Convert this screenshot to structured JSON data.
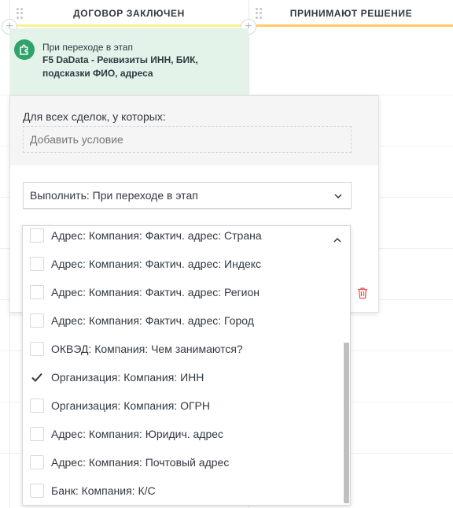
{
  "stages": [
    {
      "name": "ДОГОВОР ЗАКЛЮЧЕН",
      "color": "#f7f48a"
    },
    {
      "name": "ПРИНИМАЮТ РЕШЕНИЕ",
      "color": "#ffcc66"
    }
  ],
  "trigger": {
    "caption": "При переходе в этап",
    "title": "F5 DaData - Реквизиты ИНН, БИК, подсказки ФИО, адреса",
    "icon": "puzzle-icon"
  },
  "popup": {
    "condition_label": "Для всех сделок, у которых:",
    "condition_placeholder": "Добавить условие",
    "execute_value": "Выполнить: При переходе в этап"
  },
  "fields": [
    {
      "label": "Адрес: Компания: Фактич. адрес: Страна",
      "checked": false
    },
    {
      "label": "Адрес: Компания: Фактич. адрес: Индекс",
      "checked": false
    },
    {
      "label": "Адрес: Компания: Фактич. адрес: Регион",
      "checked": false
    },
    {
      "label": "Адрес: Компания: Фактич. адрес: Город",
      "checked": false
    },
    {
      "label": "ОКВЭД: Компания: Чем занимаются?",
      "checked": false
    },
    {
      "label": "Организация: Компания: ИНН",
      "checked": true
    },
    {
      "label": "Организация: Компания: ОГРН",
      "checked": false
    },
    {
      "label": "Адрес: Компания: Юридич. адрес",
      "checked": false
    },
    {
      "label": "Адрес: Компания: Почтовый адрес",
      "checked": false
    },
    {
      "label": "Банк: Компания: К/С",
      "checked": false
    }
  ],
  "colors": {
    "accent_green": "#30a36b",
    "trigger_bg": "#e4f3ea",
    "delete_red": "#e35a5a"
  }
}
